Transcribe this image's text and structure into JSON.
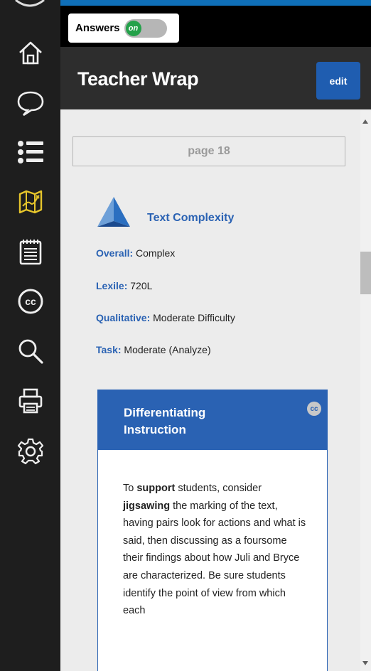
{
  "nav": {
    "items": [
      {
        "icon": "home-icon"
      },
      {
        "icon": "comment-icon"
      },
      {
        "icon": "list-icon"
      },
      {
        "icon": "map-icon",
        "active_color": "#e6c52b"
      },
      {
        "icon": "notepad-icon"
      },
      {
        "icon": "closed-captions-icon"
      },
      {
        "icon": "search-icon"
      },
      {
        "icon": "print-icon"
      },
      {
        "icon": "gear-icon"
      }
    ]
  },
  "toolbar": {
    "answers_label": "Answers",
    "toggle_label": "on"
  },
  "header": {
    "title": "Teacher Wrap",
    "edit_label": "edit"
  },
  "content": {
    "page_label": "page 18",
    "text_complexity": {
      "title": "Text Complexity",
      "rows": [
        {
          "key": "Overall:",
          "value": " Complex"
        },
        {
          "key": "Lexile:",
          "value": " 720L"
        },
        {
          "key": "Qualitative:",
          "value": " Moderate Difficulty"
        },
        {
          "key": "Task:",
          "value": " Moderate (Analyze)"
        }
      ]
    },
    "differentiating": {
      "title_line1": "Differentiating",
      "title_line2": "Instruction",
      "cc_label": "cc",
      "body": {
        "t1": "To ",
        "b1": "support",
        "t2": " students, consider ",
        "b2": "jigsawing",
        "t3": " the marking of the text, having pairs look for actions and what is said, then discussing as a foursome their findings about how Juli and Bryce are characterized. Be sure students identify the point of view from which each"
      }
    }
  },
  "colors": {
    "accent_blue": "#2a62b3",
    "toggle_on": "#24a14a",
    "active_nav": "#e6c52b"
  }
}
